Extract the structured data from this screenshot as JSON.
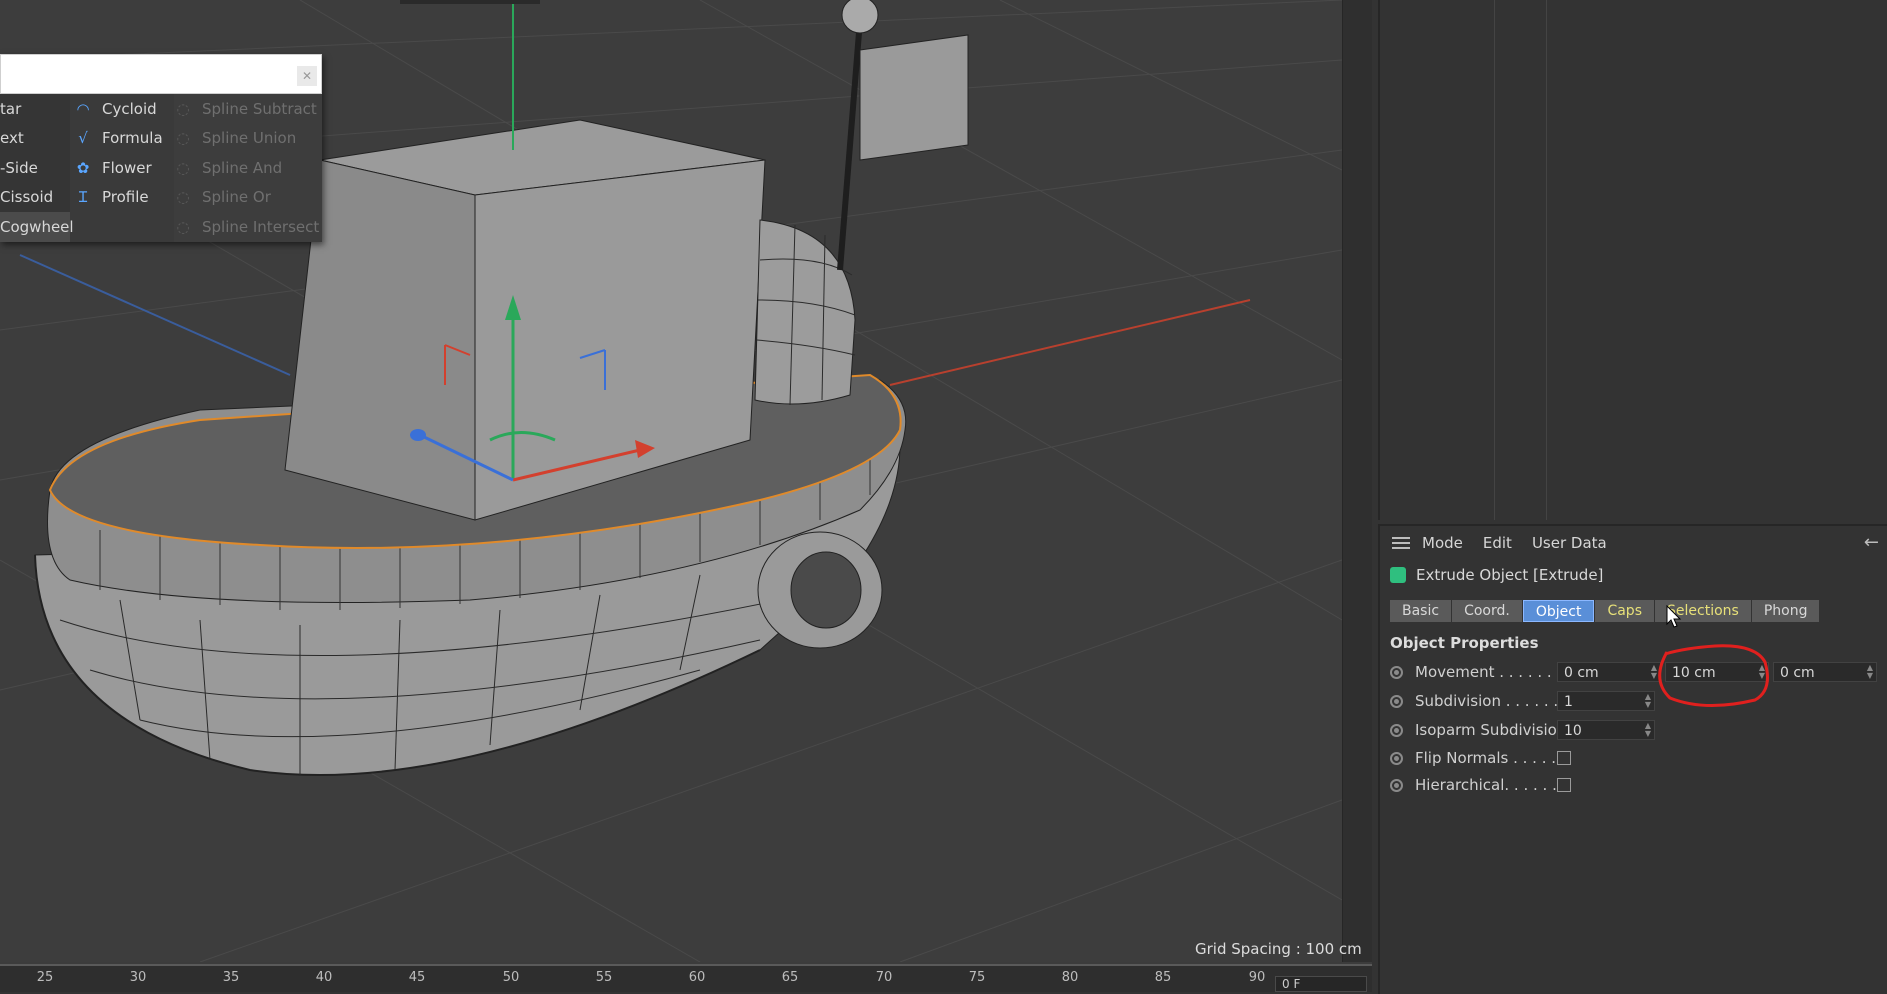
{
  "viewport": {
    "grid_spacing": "Grid Spacing : 100 cm",
    "timeline_ticks": [
      "25",
      "30",
      "35",
      "40",
      "45",
      "50",
      "55",
      "60",
      "65",
      "70",
      "75",
      "80",
      "85",
      "90"
    ],
    "frame_field": "0 F"
  },
  "spline_popup": {
    "col1": [
      "tar",
      "ext",
      "-Side",
      "Cissoid",
      "Cogwheel"
    ],
    "col2": [
      {
        "label": "Cycloid",
        "icon": "cycloid-icon"
      },
      {
        "label": "Formula",
        "icon": "formula-icon"
      },
      {
        "label": "Flower",
        "icon": "flower-icon"
      },
      {
        "label": "Profile",
        "icon": "profile-icon"
      }
    ],
    "col3": [
      "Spline Subtract",
      "Spline Union",
      "Spline And",
      "Spline Or",
      "Spline Intersect"
    ]
  },
  "attributes": {
    "menu": [
      "Mode",
      "Edit",
      "User Data"
    ],
    "object_title": "Extrude Object [Extrude]",
    "tabs": [
      {
        "label": "Basic",
        "state": "normal"
      },
      {
        "label": "Coord.",
        "state": "normal"
      },
      {
        "label": "Object",
        "state": "active"
      },
      {
        "label": "Caps",
        "state": "highlight"
      },
      {
        "label": "Selections",
        "state": "highlight"
      },
      {
        "label": "Phong",
        "state": "normal"
      }
    ],
    "section": "Object Properties",
    "properties": {
      "movement": {
        "label": "Movement . . . . . .",
        "x": "0 cm",
        "y": "10 cm",
        "z": "0 cm"
      },
      "subdivision": {
        "label": "Subdivision . . . . . .",
        "value": "1"
      },
      "isoparm": {
        "label": "Isoparm Subdivision",
        "value": "10"
      },
      "flip_normals": {
        "label": "Flip Normals . . . . .",
        "checked": false
      },
      "hierarchical": {
        "label": "Hierarchical. . . . . .",
        "checked": false
      }
    }
  },
  "colors": {
    "accent": "#5a8fd8",
    "highlight_tab": "#e7e079",
    "annotation": "#e0201e",
    "extrude_icon": "#2fbf7f"
  }
}
